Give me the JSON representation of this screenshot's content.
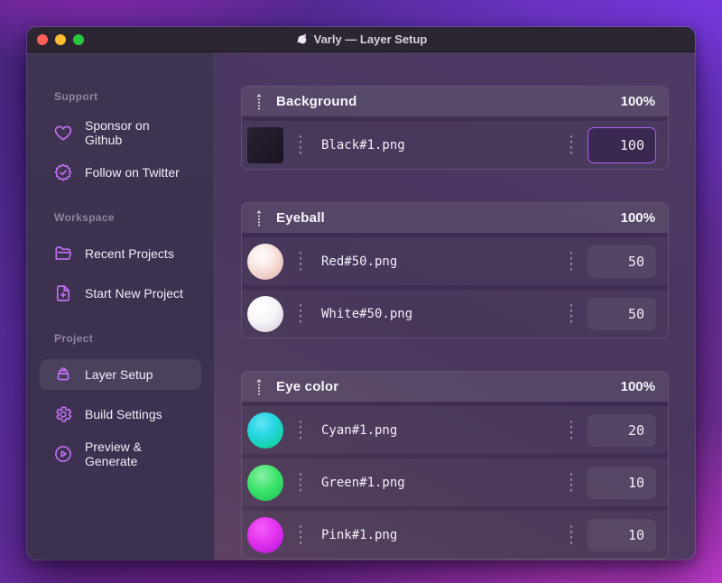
{
  "window": {
    "title": "Varly — Layer Setup"
  },
  "titlebar": {
    "buttons": [
      {
        "name": "close",
        "color": "#ff5f57"
      },
      {
        "name": "minimize",
        "color": "#febc2e"
      },
      {
        "name": "zoom",
        "color": "#28c840"
      }
    ]
  },
  "sidebar": {
    "sections": [
      {
        "label": "Support",
        "items": [
          {
            "label": "Sponsor on Github",
            "icon": "heart-icon"
          },
          {
            "label": "Follow on Twitter",
            "icon": "badge-check-icon"
          }
        ]
      },
      {
        "label": "Workspace",
        "items": [
          {
            "label": "Recent Projects",
            "icon": "folder-open-icon"
          },
          {
            "label": "Start New Project",
            "icon": "file-plus-icon"
          }
        ]
      },
      {
        "label": "Project",
        "items": [
          {
            "label": "Layer Setup",
            "icon": "toolbox-icon",
            "active": true
          },
          {
            "label": "Build Settings",
            "icon": "gear-icon"
          },
          {
            "label": "Preview & Generate",
            "icon": "play-circle-icon"
          }
        ]
      }
    ]
  },
  "layer_groups": [
    {
      "name": "Background",
      "weight": "100%",
      "layers": [
        {
          "file": "Black#1.png",
          "value": "100",
          "thumb": "black-square-thumb",
          "focused": true
        }
      ]
    },
    {
      "name": "Eyeball",
      "weight": "100%",
      "layers": [
        {
          "file": "Red#50.png",
          "value": "50",
          "thumb": "red-pearl-thumb"
        },
        {
          "file": "White#50.png",
          "value": "50",
          "thumb": "white-pearl-thumb"
        }
      ]
    },
    {
      "name": "Eye color",
      "weight": "100%",
      "layers": [
        {
          "file": "Cyan#1.png",
          "value": "20",
          "thumb": "cyan-ball-thumb"
        },
        {
          "file": "Green#1.png",
          "value": "10",
          "thumb": "green-ball-thumb"
        },
        {
          "file": "Pink#1.png",
          "value": "10",
          "thumb": "pink-ball-thumb"
        }
      ]
    }
  ],
  "colors": {
    "accent": "#b45ef5",
    "sidebar_icon": "#c26ff2",
    "traffic_close": "#ff5f57",
    "traffic_minimize": "#febc2e",
    "traffic_zoom": "#28c840"
  }
}
